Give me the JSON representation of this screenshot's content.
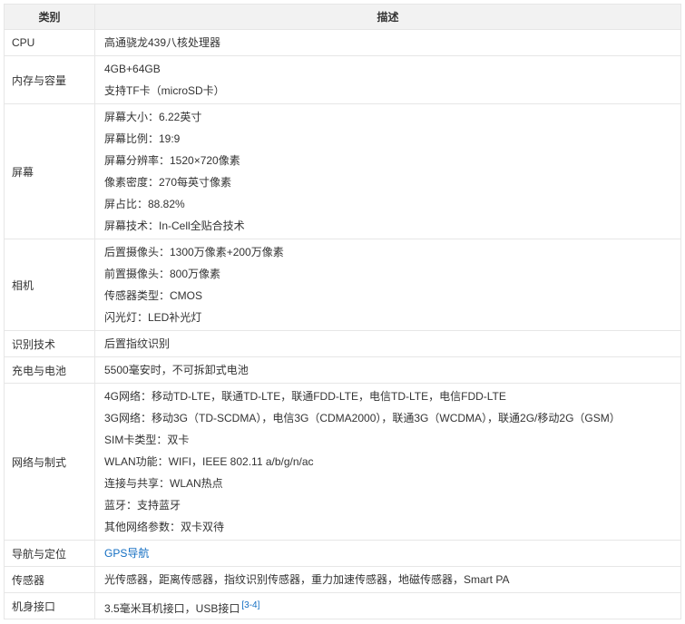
{
  "table": {
    "headers": {
      "category": "类别",
      "description": "描述"
    },
    "rows": [
      {
        "category": "CPU",
        "lines": [
          "高通骁龙439八核处理器"
        ]
      },
      {
        "category": "内存与容量",
        "lines": [
          "4GB+64GB",
          "支持TF卡（microSD卡）"
        ]
      },
      {
        "category": "屏幕",
        "lines": [
          "屏幕大小：6.22英寸",
          "屏幕比例：19:9",
          "屏幕分辨率：1520×720像素",
          "像素密度：270每英寸像素",
          "屏占比：88.82%",
          "屏幕技术：In-Cell全贴合技术"
        ]
      },
      {
        "category": "相机",
        "lines": [
          "后置摄像头：1300万像素+200万像素",
          "前置摄像头：800万像素",
          "传感器类型：CMOS",
          "闪光灯：LED补光灯"
        ]
      },
      {
        "category": "识别技术",
        "lines": [
          "后置指纹识别"
        ]
      },
      {
        "category": "充电与电池",
        "lines": [
          "5500毫安时，不可拆卸式电池"
        ]
      },
      {
        "category": "网络与制式",
        "lines": [
          "4G网络：移动TD-LTE，联通TD-LTE，联通FDD-LTE，电信TD-LTE，电信FDD-LTE",
          "3G网络：移动3G（TD-SCDMA），电信3G（CDMA2000），联通3G（WCDMA），联通2G/移动2G（GSM）",
          "SIM卡类型：双卡",
          "WLAN功能：WIFI，IEEE 802.11 a/b/g/n/ac",
          "连接与共享：WLAN热点",
          "蓝牙：支持蓝牙",
          "其他网络参数：双卡双待"
        ]
      },
      {
        "category": "导航与定位",
        "link": "GPS导航"
      },
      {
        "category": "传感器",
        "lines": [
          "光传感器，距离传感器，指纹识别传感器，重力加速传感器，地磁传感器，Smart PA"
        ]
      },
      {
        "category": "机身接口",
        "lines": [
          "3.5毫米耳机接口，USB接口"
        ],
        "ref": "[3-4]"
      }
    ]
  }
}
